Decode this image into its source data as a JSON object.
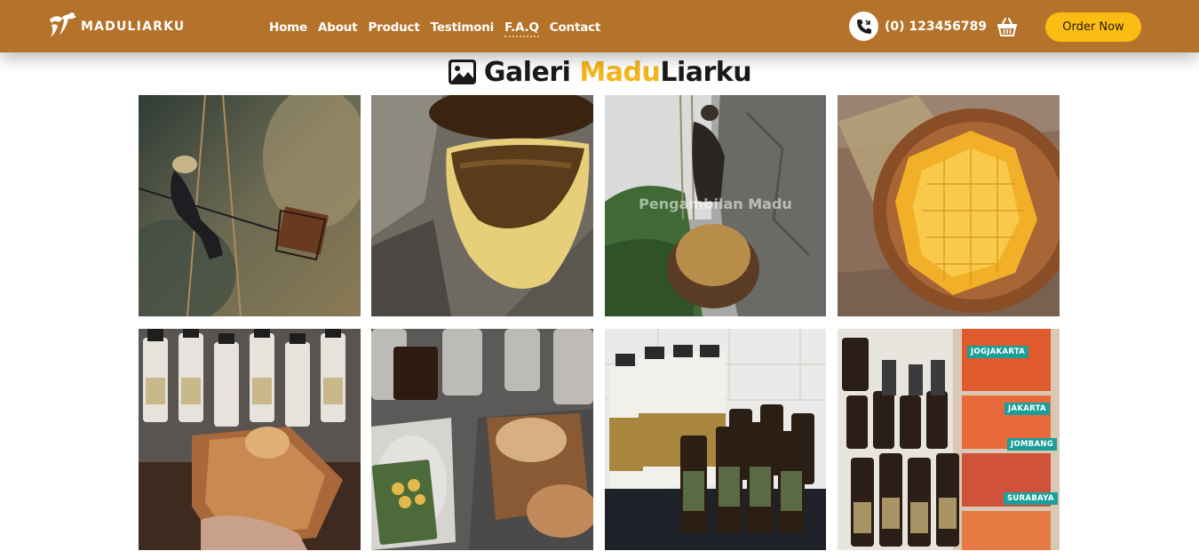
{
  "brand": {
    "name": "MADULIARKU"
  },
  "nav": {
    "links": [
      "Home",
      "About",
      "Product",
      "Testimoni",
      "F.A.Q",
      "Contact"
    ]
  },
  "contact": {
    "phone": "(0) 123456789"
  },
  "cta": {
    "order_label": "Order Now"
  },
  "icons": {
    "phone": "phone-icon",
    "cart": "basket-icon",
    "gallery": "image-gallery-icon"
  },
  "colors": {
    "navbar": "#b5722a",
    "accent": "#f5b51b",
    "button": "#fbbd14",
    "tag": "#1a9f9a"
  },
  "gallery": {
    "title_part1": "Galeri ",
    "title_highlight": "Madu",
    "title_part2": "Liarku",
    "items": [
      {
        "alt": "honey hunter climbing rope ladder on cliff"
      },
      {
        "alt": "wild honeycomb on rock"
      },
      {
        "alt": "honey hunter lowering basket",
        "overlay": "Pengambilan Madu"
      },
      {
        "alt": "honeycomb in wooden bowl"
      },
      {
        "alt": "honeycomb in hand with bottles"
      },
      {
        "alt": "honeycomb on scale with Madu Hutan label"
      },
      {
        "alt": "Madu Hutan bottles on counter"
      },
      {
        "alt": "bottles and packages for shipping",
        "tags": [
          "JOGJAKARTA",
          "JAKARTA",
          "JOMBANG",
          "SURABAYA"
        ]
      }
    ]
  }
}
